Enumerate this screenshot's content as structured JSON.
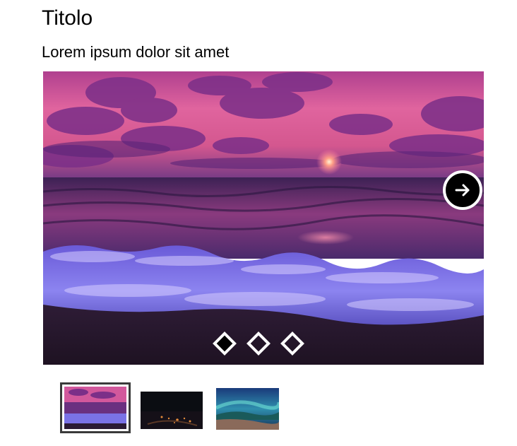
{
  "page": {
    "title": "Titolo",
    "subtitle": "Lorem ipsum dolor sit amet"
  },
  "slider": {
    "current_slide": 1,
    "slide_count": 3,
    "controls": {
      "next_icon": "arrow-right-icon",
      "pager_icon": "diamond-icon"
    }
  },
  "thumbnails": [
    {
      "label": "",
      "selected": true
    },
    {
      "label": "",
      "selected": false
    },
    {
      "label": "",
      "selected": false
    }
  ],
  "colors": {
    "accent": "#000000",
    "control_border": "#ffffff",
    "thumbnail_frame": "#3a3a3a"
  }
}
